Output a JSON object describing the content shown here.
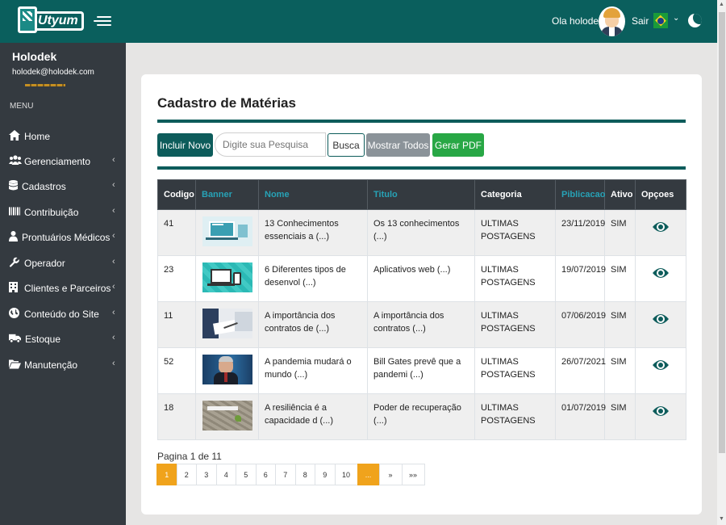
{
  "brand": {
    "logo_text": "Utyum"
  },
  "topbar": {
    "greeting": "Ola holodek",
    "logout": "Sair",
    "language": "pt-BR",
    "colors": {
      "bar": "#0a5f5d"
    }
  },
  "sidebar": {
    "user_name": "Holodek",
    "user_email": "holodek@holodek.com",
    "menu_label": "MENU",
    "items": [
      {
        "label": "Home",
        "icon": "home-icon",
        "has_children": false
      },
      {
        "label": "Gerenciamento",
        "icon": "users-icon",
        "has_children": true
      },
      {
        "label": "Cadastros",
        "icon": "database-icon",
        "has_children": true
      },
      {
        "label": "Contribuição",
        "icon": "barcode-icon",
        "has_children": true
      },
      {
        "label": "Prontuários Médicos",
        "icon": "user-md-icon",
        "has_children": true
      },
      {
        "label": "Operador",
        "icon": "wrench-icon",
        "has_children": true
      },
      {
        "label": "Clientes e Parceiros",
        "icon": "building-icon",
        "has_children": true
      },
      {
        "label": "Conteúdo do Site",
        "icon": "globe-icon",
        "has_children": true
      },
      {
        "label": "Estoque",
        "icon": "truck-icon",
        "has_children": true
      },
      {
        "label": "Manutenção",
        "icon": "folder-open-icon",
        "has_children": true
      }
    ]
  },
  "main": {
    "title": "Cadastro de Matérias",
    "toolbar": {
      "new_label": "Incluir Novo",
      "search_placeholder": "Digite sua Pesquisa",
      "search_label": "Busca",
      "show_all_label": "Mostrar Todos",
      "pdf_label": "Gerar PDF"
    },
    "table": {
      "headers": [
        "Codigo",
        "Banner",
        "Nome",
        "Titulo",
        "Categoria",
        "Piblicacao",
        "Ativo",
        "Opçoes"
      ],
      "rows": [
        {
          "codigo": "41",
          "banner": "laptop-illustration",
          "nome": "13 Conhecimentos essenciais a (...)",
          "titulo": "Os 13 conhecimentos (...)",
          "categoria": "ULTIMAS POSTAGENS",
          "publicacao": "23/11/2019",
          "ativo": "SIM"
        },
        {
          "codigo": "23",
          "banner": "devices-illustration",
          "nome": "6 Diferentes tipos de desenvol (...)",
          "titulo": "Aplicativos web (...)",
          "categoria": "ULTIMAS POSTAGENS",
          "publicacao": "19/07/2019",
          "ativo": "SIM"
        },
        {
          "codigo": "11",
          "banner": "contract-signing-photo",
          "nome": "A importância dos contratos de (...)",
          "titulo": "A importância dos contratos (...)",
          "categoria": "ULTIMAS POSTAGENS",
          "publicacao": "07/06/2019",
          "ativo": "SIM"
        },
        {
          "codigo": "52",
          "banner": "bill-gates-photo",
          "nome": "A pandemia mudará o mundo (...)",
          "titulo": "Bill Gates prevê que a pandemi (...)",
          "categoria": "ULTIMAS POSTAGENS",
          "publicacao": "26/07/2021",
          "ativo": "SIM"
        },
        {
          "codigo": "18",
          "banner": "resiliencia-image",
          "nome": "A resiliência é a capacidade d (...)",
          "titulo": "Poder de recuperação (...)",
          "categoria": "ULTIMAS POSTAGENS",
          "publicacao": "01/07/2019",
          "ativo": "SIM"
        }
      ]
    },
    "pagination": {
      "info": "Pagina 1 de 11",
      "pages": [
        "1",
        "2",
        "3",
        "4",
        "5",
        "6",
        "7",
        "8",
        "9",
        "10",
        "...",
        "»",
        "»»"
      ],
      "current": "1"
    }
  }
}
